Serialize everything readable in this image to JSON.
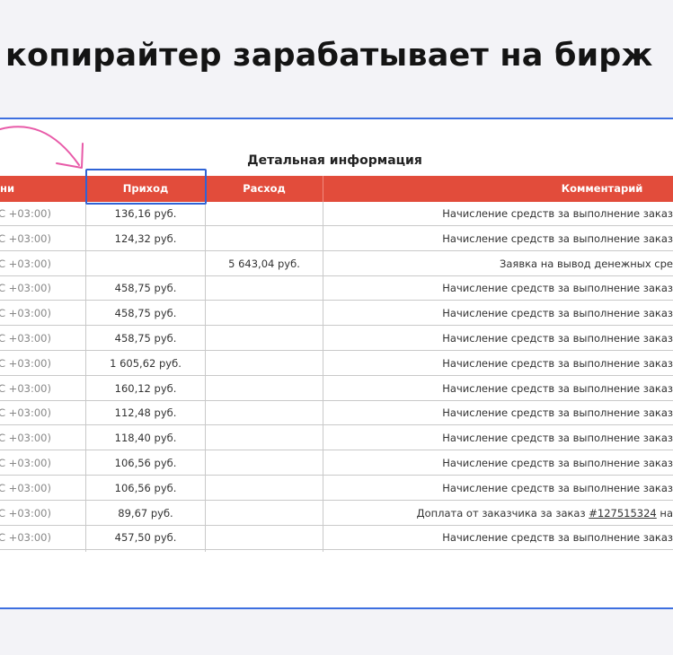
{
  "headline": "копирайтер зарабатывает на бирж",
  "panel_title": "Детальная информация",
  "columns": {
    "time": "ни",
    "income": "Приход",
    "expense": "Расход",
    "comment": "Комментарий"
  },
  "rows": [
    {
      "time": "C +03:00)",
      "income": "136,16 руб.",
      "expense": "",
      "comment": "Начисление средств за выполнение заказ"
    },
    {
      "time": "C +03:00)",
      "income": "124,32 руб.",
      "expense": "",
      "comment": "Начисление средств за выполнение заказ"
    },
    {
      "time": "C +03:00)",
      "income": "",
      "expense": "5 643,04 руб.",
      "comment": "Заявка на вывод денежных сре"
    },
    {
      "time": "C +03:00)",
      "income": "458,75 руб.",
      "expense": "",
      "comment": "Начисление средств за выполнение заказ"
    },
    {
      "time": "C +03:00)",
      "income": "458,75 руб.",
      "expense": "",
      "comment": "Начисление средств за выполнение заказ"
    },
    {
      "time": "C +03:00)",
      "income": "458,75 руб.",
      "expense": "",
      "comment": "Начисление средств за выполнение заказ"
    },
    {
      "time": "C +03:00)",
      "income": "1 605,62 руб.",
      "expense": "",
      "comment": "Начисление средств за выполнение заказ"
    },
    {
      "time": "C +03:00)",
      "income": "160,12 руб.",
      "expense": "",
      "comment": "Начисление средств за выполнение заказ"
    },
    {
      "time": "C +03:00)",
      "income": "112,48 руб.",
      "expense": "",
      "comment": "Начисление средств за выполнение заказ"
    },
    {
      "time": "C +03:00)",
      "income": "118,40 руб.",
      "expense": "",
      "comment": "Начисление средств за выполнение заказ"
    },
    {
      "time": "C +03:00)",
      "income": "106,56 руб.",
      "expense": "",
      "comment": "Начисление средств за выполнение заказ"
    },
    {
      "time": "C +03:00)",
      "income": "106,56 руб.",
      "expense": "",
      "comment": "Начисление средств за выполнение заказ"
    },
    {
      "time": "C +03:00)",
      "income": "89,67 руб.",
      "expense": "",
      "comment_prefix": "Доплата от заказчика за заказ ",
      "comment_link": "#127515324",
      "comment_suffix": " на"
    },
    {
      "time": "C +03:00)",
      "income": "457,50 руб.",
      "expense": "",
      "comment": "Начисление средств за выполнение заказ"
    }
  ],
  "colors": {
    "header_red": "#e24c3b",
    "frame_blue": "#3d6fe0",
    "highlight_blue": "#2f63d6",
    "arrow_pink": "#e85aa8",
    "link_blue": "#1f63b4"
  }
}
